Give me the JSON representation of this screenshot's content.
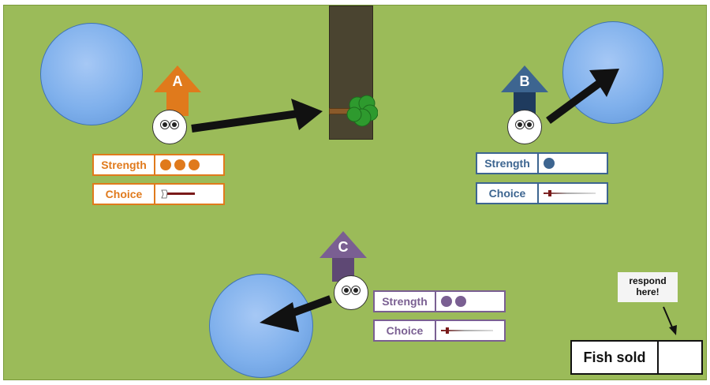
{
  "players": [
    {
      "letter": "A",
      "strength_label": "Strength",
      "choice_label": "Choice",
      "strength": 3,
      "choice_tool": "axe-icon",
      "color": "#e07a1c",
      "dark": "#c7641a"
    },
    {
      "letter": "B",
      "strength_label": "Strength",
      "choice_label": "Choice",
      "strength": 1,
      "choice_tool": "fishing-rod-icon",
      "color": "#3d6590",
      "dark": "#1f3b5e"
    },
    {
      "letter": "C",
      "strength_label": "Strength",
      "choice_label": "Choice",
      "strength": 2,
      "choice_tool": "fishing-rod-icon",
      "color": "#7a5f92",
      "dark": "#5e4874"
    }
  ],
  "respond": {
    "note": "respond here!",
    "field_label": "Fish sold",
    "field_value": ""
  },
  "colors": {
    "grass": "#9bbb59",
    "pond": "#7fb0ec",
    "trunk": "#4a4430",
    "leaves": "#2e9a2e"
  }
}
